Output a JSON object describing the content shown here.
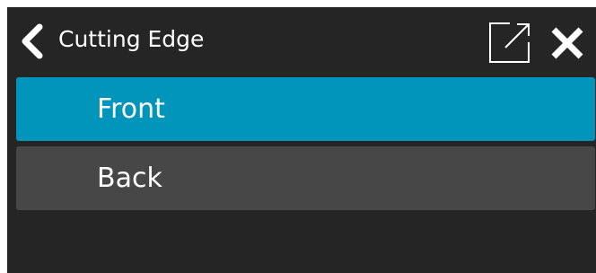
{
  "header": {
    "title": "Cutting Edge",
    "back_icon": "chevron-left-icon",
    "popout_icon": "external-link-icon",
    "close_icon": "close-icon"
  },
  "menu": {
    "items": [
      {
        "label": "Front",
        "selected": true
      },
      {
        "label": "Back",
        "selected": false
      }
    ]
  },
  "colors": {
    "background": "#252525",
    "selected": "#0195bb",
    "item": "#474747",
    "text": "#ffffff"
  }
}
